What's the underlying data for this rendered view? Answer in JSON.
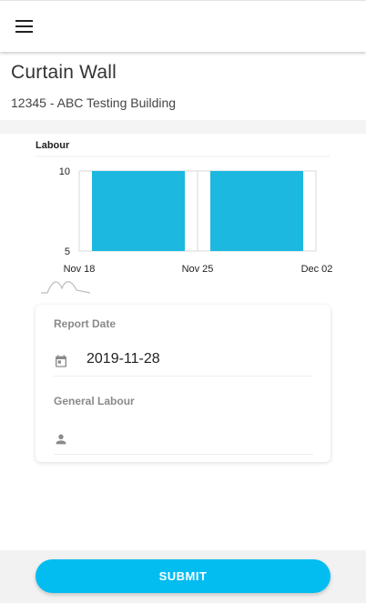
{
  "appbar": {
    "menu_icon": "hamburger-menu-icon"
  },
  "page": {
    "title": "Curtain Wall",
    "subtitle": "12345 - ABC Testing Building"
  },
  "chart_data": {
    "type": "bar",
    "title": "Labour",
    "categories": [
      "Nov 18",
      "Nov 25"
    ],
    "values": [
      10,
      10
    ],
    "x_ticks": [
      "Nov 18",
      "Nov 25",
      "Dec 02"
    ],
    "y_ticks": [
      10,
      5
    ],
    "ylim": [
      5,
      10
    ],
    "bar_color": "#1cb8e0",
    "grid": true
  },
  "form": {
    "report_date": {
      "label": "Report Date",
      "value": "2019-11-28",
      "icon": "calendar-icon"
    },
    "general_labour": {
      "label": "General Labour",
      "value": "",
      "icon": "person-icon"
    }
  },
  "footer": {
    "submit_label": "SUBMIT",
    "accent": "#03bdf1"
  }
}
